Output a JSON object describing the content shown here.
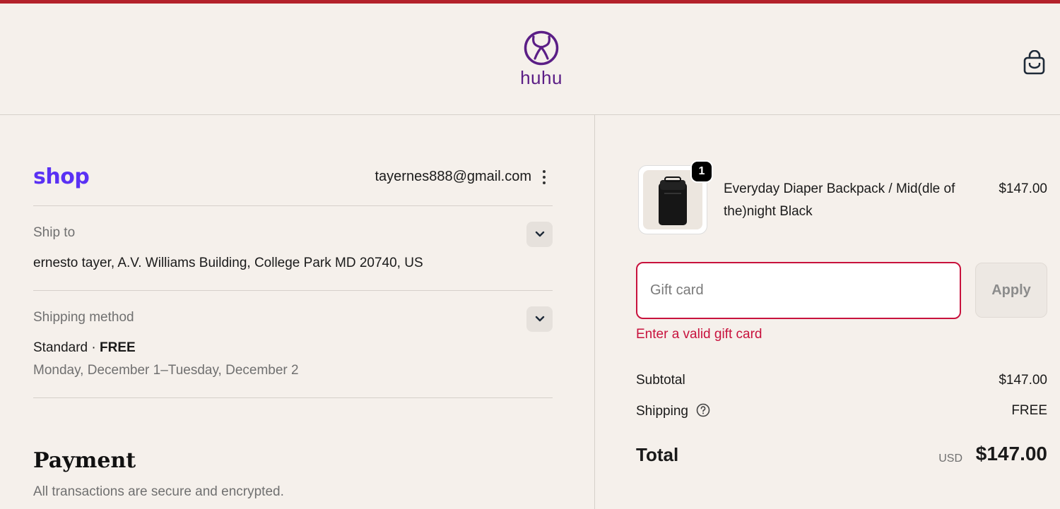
{
  "brand": {
    "name": "huhu",
    "color": "#5b1e86",
    "accent_bar_color": "#b3222b"
  },
  "header": {
    "cart_icon": "shopping-bag-icon"
  },
  "account": {
    "shop_logo_text": "shop",
    "shop_color": "#5a31f4",
    "email": "tayernes888@gmail.com",
    "menu_icon": "kebab-icon"
  },
  "ship_to": {
    "label": "Ship to",
    "value": "ernesto tayer, A.V. Williams Building, College Park MD 20740, US"
  },
  "shipping_method": {
    "label": "Shipping method",
    "name": "Standard",
    "separator": "·",
    "price": "FREE",
    "delivery": "Monday, December 1–Tuesday, December 2"
  },
  "payment": {
    "title": "Payment",
    "subtitle": "All transactions are secure and encrypted."
  },
  "order": {
    "item": {
      "quantity": "1",
      "name": "Everyday Diaper Backpack / Mid(dle of the)night Black",
      "price": "$147.00"
    },
    "gift_card": {
      "placeholder": "Gift card",
      "value": "",
      "apply_label": "Apply",
      "error": "Enter a valid gift card",
      "error_color": "#c8123d"
    },
    "summary": {
      "subtotal_label": "Subtotal",
      "subtotal_value": "$147.00",
      "shipping_label": "Shipping",
      "shipping_value": "FREE",
      "total_label": "Total",
      "currency": "USD",
      "total_value": "$147.00"
    }
  }
}
